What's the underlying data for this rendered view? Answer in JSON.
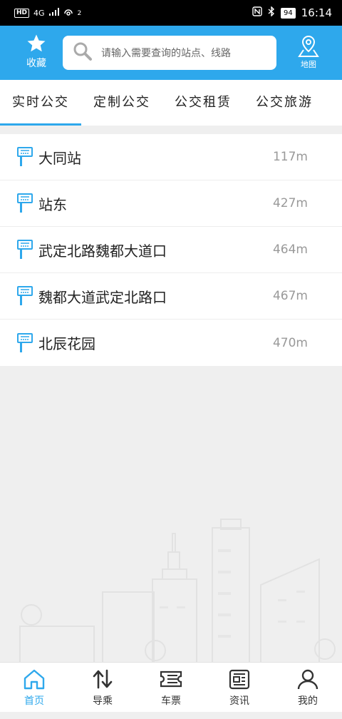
{
  "status_bar": {
    "left_badge": "HD",
    "network": "4G",
    "hotspot_count": "2",
    "battery": "94",
    "time": "16:14"
  },
  "header": {
    "favorites_label": "收藏",
    "search_placeholder": "请输入需要查询的站点、线路",
    "map_label": "地图"
  },
  "tabs": [
    {
      "label": "实时公交",
      "active": true
    },
    {
      "label": "定制公交",
      "active": false
    },
    {
      "label": "公交租赁",
      "active": false
    },
    {
      "label": "公交旅游",
      "active": false
    }
  ],
  "stops": [
    {
      "name": "大同站",
      "distance": "117m"
    },
    {
      "name": "站东",
      "distance": "427m"
    },
    {
      "name": "武定北路魏都大道口",
      "distance": "464m"
    },
    {
      "name": "魏都大道武定北路口",
      "distance": "467m"
    },
    {
      "name": "北辰花园",
      "distance": "470m"
    }
  ],
  "bottom_nav": [
    {
      "label": "首页",
      "icon": "home-icon",
      "active": true
    },
    {
      "label": "导乘",
      "icon": "transfer-icon",
      "active": false
    },
    {
      "label": "车票",
      "icon": "ticket-icon",
      "active": false
    },
    {
      "label": "资讯",
      "icon": "news-icon",
      "active": false
    },
    {
      "label": "我的",
      "icon": "profile-icon",
      "active": false
    }
  ],
  "colors": {
    "accent": "#2ea8ec",
    "background": "#efefef",
    "distance_text": "#999999"
  }
}
